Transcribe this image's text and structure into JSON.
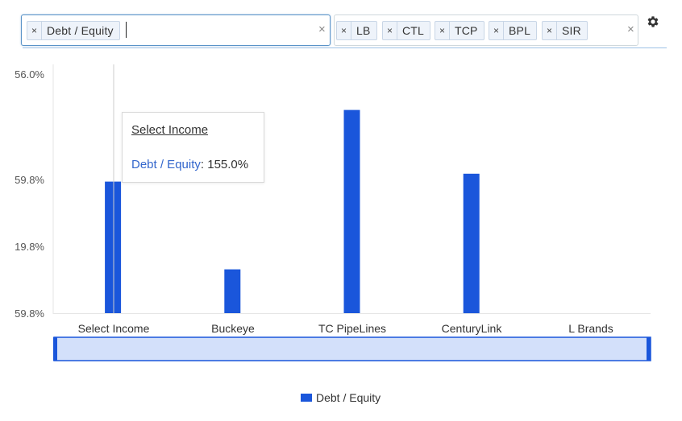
{
  "metric_selector": {
    "chips": [
      {
        "label": "Debt / Equity"
      }
    ],
    "clear_symbol": "×"
  },
  "company_selector": {
    "chips": [
      {
        "label": "LB"
      },
      {
        "label": "CTL"
      },
      {
        "label": "TCP"
      },
      {
        "label": "BPL"
      },
      {
        "label": "SIR"
      }
    ],
    "clear_symbol": "×"
  },
  "settings": {
    "icon": "gear-icon"
  },
  "tooltip": {
    "title": "Select Income",
    "metric": "Debt / Equity",
    "separator": ":",
    "value": "155.0%"
  },
  "legend": {
    "label": "Debt / Equity"
  },
  "colors": {
    "bar": "#1a56db",
    "navigator_fill": "#d3e0fa",
    "navigator_border": "#1a56db"
  },
  "chart_data": {
    "type": "bar",
    "categories": [
      "Select Income",
      "Buckeye",
      "TC PipeLines",
      "CenturyLink",
      "L Brands"
    ],
    "series": [
      {
        "name": "Debt / Equity",
        "values": [
          155.0,
          89.0,
          209.0,
          161.0,
          null
        ]
      }
    ],
    "y_tick_labels": [
      "56.0%",
      "59.8%",
      "19.8%",
      "59.8%"
    ],
    "ylim": [
      56,
      236
    ],
    "grid": false,
    "legend_position": "bottom"
  }
}
